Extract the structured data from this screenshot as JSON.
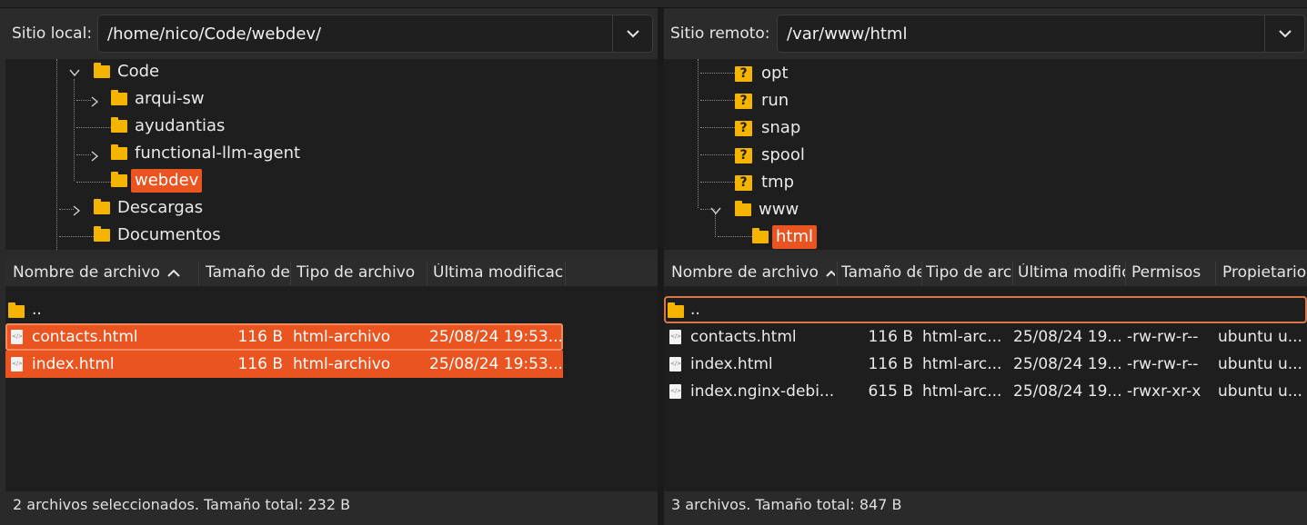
{
  "local": {
    "site_label": "Sitio local:",
    "path": "/home/nico/Code/webdev/",
    "tree": [
      {
        "name": "Code"
      },
      {
        "name": "arqui-sw"
      },
      {
        "name": "ayudantias"
      },
      {
        "name": "functional-llm-agent"
      },
      {
        "name": "webdev"
      },
      {
        "name": "Descargas"
      },
      {
        "name": "Documentos"
      }
    ],
    "columns": [
      "Nombre de archivo",
      "Tamaño de",
      "Tipo de archivo",
      "Última modificac"
    ],
    "parent_dir": "..",
    "files": [
      {
        "name": "contacts.html",
        "size": "116 B",
        "type": "html-archivo",
        "modified": "25/08/24 19:53..."
      },
      {
        "name": "index.html",
        "size": "116 B",
        "type": "html-archivo",
        "modified": "25/08/24 19:53..."
      }
    ],
    "status": "2 archivos seleccionados. Tamaño total: 232 B"
  },
  "remote": {
    "site_label": "Sitio remoto:",
    "path": "/var/www/html",
    "tree": [
      {
        "name": "opt"
      },
      {
        "name": "run"
      },
      {
        "name": "snap"
      },
      {
        "name": "spool"
      },
      {
        "name": "tmp"
      },
      {
        "name": "www"
      },
      {
        "name": "html"
      }
    ],
    "unknown_glyph": "?",
    "columns": [
      "Nombre de archivo",
      "Tamaño de",
      "Tipo de arc",
      "Última modific",
      "Permisos",
      "Propietario"
    ],
    "parent_dir": "..",
    "files": [
      {
        "name": "contacts.html",
        "size": "116 B",
        "type": "html-arc...",
        "modified": "25/08/24 19...",
        "perms": "-rw-rw-r--",
        "owner": "ubuntu u..."
      },
      {
        "name": "index.html",
        "size": "116 B",
        "type": "html-arc...",
        "modified": "25/08/24 19...",
        "perms": "-rw-rw-r--",
        "owner": "ubuntu u..."
      },
      {
        "name": "index.nginx-debi...",
        "size": "615 B",
        "type": "html-arc...",
        "modified": "25/08/24 19...",
        "perms": "-rwxr-xr-x",
        "owner": "ubuntu u..."
      }
    ],
    "status": "3 archivos. Tamaño total: 847 B"
  },
  "colors": {
    "accent": "#e95420",
    "folder": "#f5b400",
    "background": "#1e1e1e"
  }
}
